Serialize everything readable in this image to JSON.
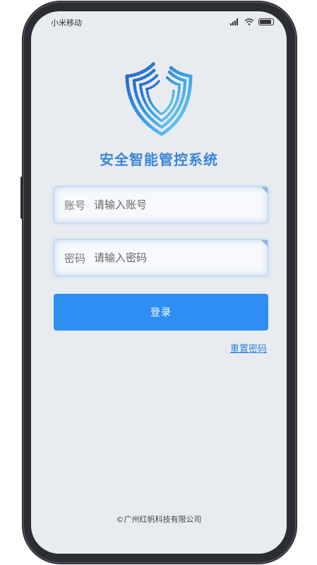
{
  "status_bar": {
    "carrier": "小米移动",
    "icons": [
      "signal-icon",
      "wifi-icon",
      "battery-icon"
    ]
  },
  "app": {
    "logo_icon": "shield-logo-icon",
    "title": "安全智能管控系统"
  },
  "form": {
    "account": {
      "label": "账号",
      "placeholder": "请输入账号",
      "value": ""
    },
    "password": {
      "label": "密码",
      "placeholder": "请输入密码",
      "value": ""
    },
    "login_label": "登录",
    "reset_label": "重置密码"
  },
  "footer": {
    "copyright": "©广州红帆科技有限公司"
  },
  "colors": {
    "primary": "#2e8ef2",
    "title": "#3a86d6",
    "link": "#2e84dd",
    "screen_bg": "#e8ecf1",
    "phone_frame": "#2b2d33"
  }
}
